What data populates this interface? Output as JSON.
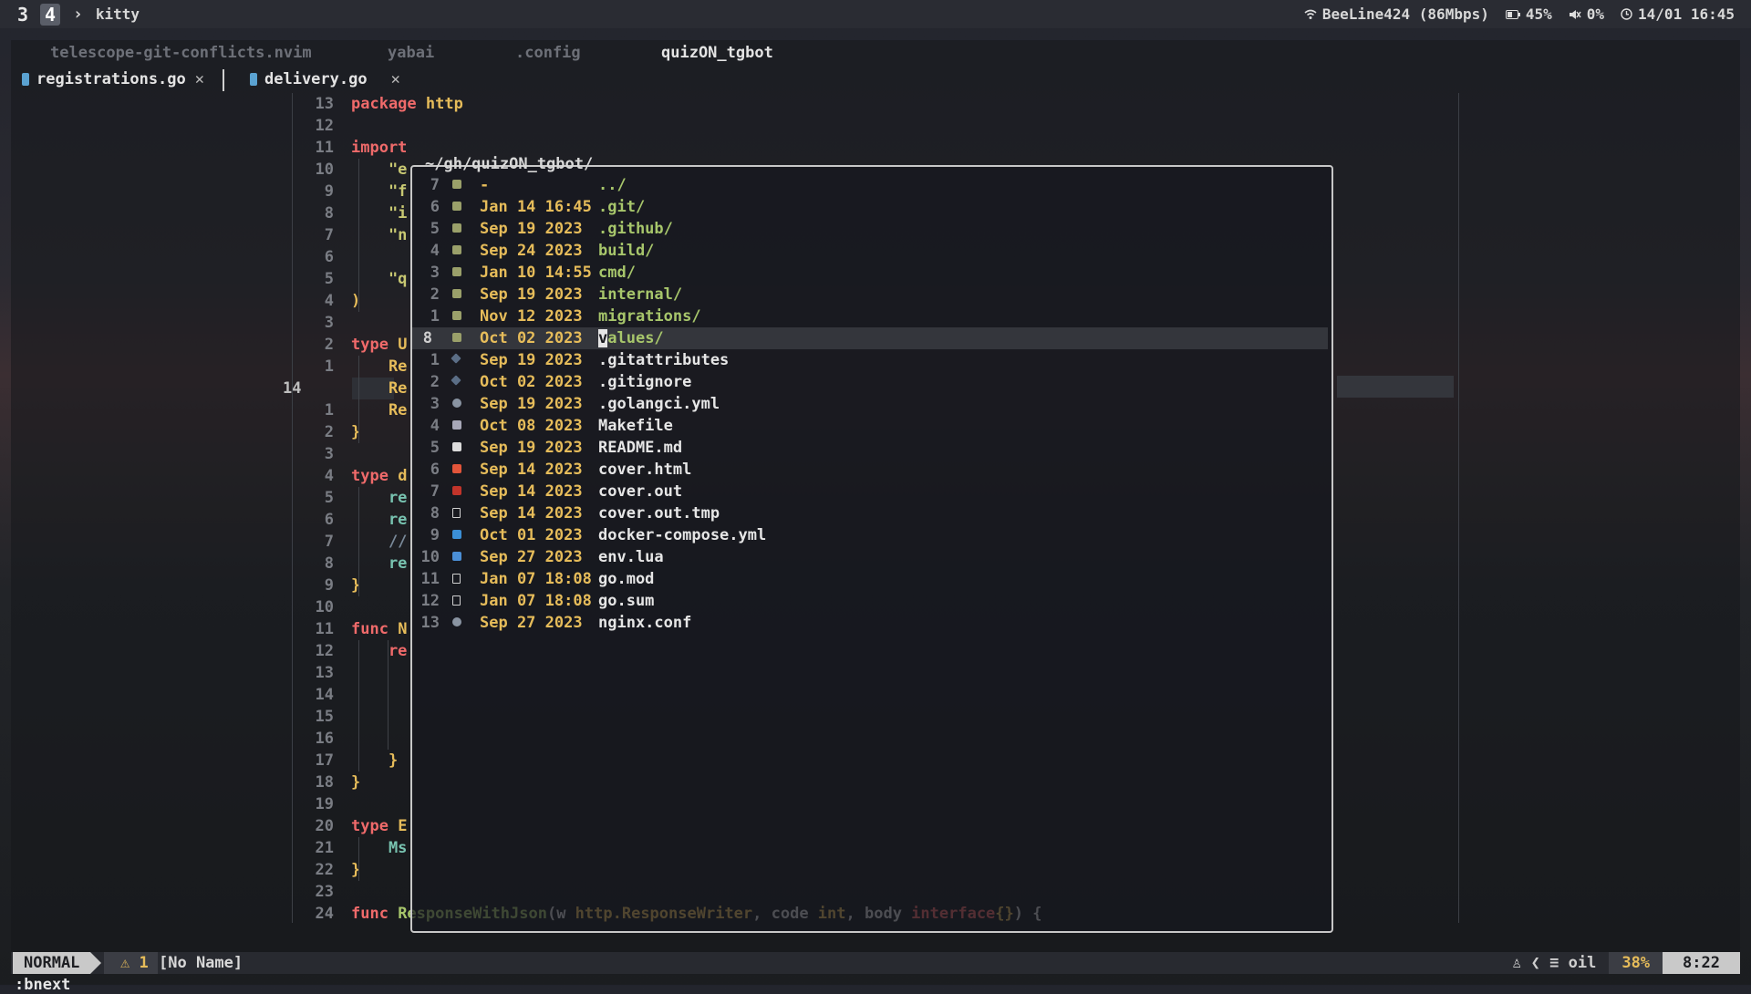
{
  "topbar": {
    "workspaces": [
      "3",
      "4"
    ],
    "active_workspace": "4",
    "chevron": "›",
    "app": "kitty",
    "wifi": "BeeLine424 (86Mbps)",
    "battery": "45%",
    "volume": "0%",
    "clock": "14/01 16:45"
  },
  "tabline": {
    "tabs": [
      "telescope-git-conflicts.nvim",
      "yabai",
      ".config",
      "quizON_tgbot"
    ],
    "current": "quizON_tgbot"
  },
  "buffers": [
    {
      "name": "registrations.go",
      "close": "✕"
    },
    {
      "name": "delivery.go",
      "close": "✕"
    }
  ],
  "editor": {
    "lines": [
      {
        "n": "13",
        "code": [
          [
            "kw",
            "package "
          ],
          [
            "ty",
            "http"
          ]
        ]
      },
      {
        "n": "12",
        "code": []
      },
      {
        "n": "11",
        "code": [
          [
            "kw",
            "import"
          ]
        ]
      },
      {
        "n": "10",
        "code": [
          [
            "str",
            "    \"e"
          ]
        ]
      },
      {
        "n": "9",
        "code": [
          [
            "str",
            "    \"f"
          ]
        ]
      },
      {
        "n": "8",
        "code": [
          [
            "str",
            "    \"i"
          ]
        ]
      },
      {
        "n": "7",
        "code": [
          [
            "str",
            "    \"n"
          ]
        ]
      },
      {
        "n": "6",
        "code": []
      },
      {
        "n": "5",
        "code": [
          [
            "str",
            "    \"q"
          ]
        ]
      },
      {
        "n": "4",
        "code": [
          [
            "ty",
            ")"
          ]
        ]
      },
      {
        "n": "3",
        "code": []
      },
      {
        "n": "2",
        "code": [
          [
            "kw",
            "type "
          ],
          [
            "ty",
            "U"
          ]
        ]
      },
      {
        "n": "1",
        "code": [
          [
            "ty",
            "    Re"
          ]
        ]
      },
      {
        "n": "14",
        "code": [
          [
            "ty",
            "    Re"
          ]
        ],
        "current": true
      },
      {
        "n": "1",
        "code": [
          [
            "ty",
            "    Re"
          ]
        ]
      },
      {
        "n": "2",
        "code": [
          [
            "ty",
            "}"
          ]
        ]
      },
      {
        "n": "3",
        "code": []
      },
      {
        "n": "4",
        "code": [
          [
            "kw",
            "type "
          ],
          [
            "ty",
            "d"
          ]
        ]
      },
      {
        "n": "5",
        "code": [
          [
            "teal",
            "    re"
          ]
        ]
      },
      {
        "n": "6",
        "code": [
          [
            "teal",
            "    re"
          ]
        ]
      },
      {
        "n": "7",
        "code": [
          [
            "cm",
            "    //"
          ]
        ]
      },
      {
        "n": "8",
        "code": [
          [
            "teal",
            "    re"
          ]
        ]
      },
      {
        "n": "9",
        "code": [
          [
            "ty",
            "}"
          ]
        ]
      },
      {
        "n": "10",
        "code": []
      },
      {
        "n": "11",
        "code": [
          [
            "kw",
            "func "
          ],
          [
            "ty",
            "N"
          ]
        ]
      },
      {
        "n": "12",
        "code": [
          [
            "kw",
            "    re"
          ]
        ]
      },
      {
        "n": "13",
        "code": []
      },
      {
        "n": "14",
        "code": []
      },
      {
        "n": "15",
        "code": []
      },
      {
        "n": "16",
        "code": []
      },
      {
        "n": "17",
        "code": [
          [
            "ty",
            "    }"
          ]
        ]
      },
      {
        "n": "18",
        "code": [
          [
            "ty",
            "}"
          ]
        ]
      },
      {
        "n": "19",
        "code": []
      },
      {
        "n": "20",
        "code": [
          [
            "kw",
            "type "
          ],
          [
            "ty",
            "E"
          ]
        ]
      },
      {
        "n": "21",
        "code": [
          [
            "teal",
            "    Ms"
          ]
        ]
      },
      {
        "n": "22",
        "code": [
          [
            "ty",
            "}"
          ]
        ]
      },
      {
        "n": "23",
        "code": []
      },
      {
        "n": "24",
        "code": [
          [
            "kw",
            "func "
          ],
          [
            "fn",
            "ResponseWithJson"
          ],
          [
            "plain",
            "(w "
          ],
          [
            "ty",
            "http.ResponseWriter"
          ],
          [
            "plain",
            ", code "
          ],
          [
            "ty",
            "int"
          ],
          [
            "plain",
            ", body "
          ],
          [
            "kw",
            "interface"
          ],
          [
            "ty",
            "{}"
          ],
          [
            "plain",
            ") {"
          ]
        ]
      }
    ]
  },
  "oil": {
    "title": "~/gh/quizON_tgbot/",
    "entries": [
      {
        "idx": "7",
        "icon": "folder-icon",
        "date": "-",
        "name": "../",
        "dir": true
      },
      {
        "idx": "6",
        "icon": "folder-icon",
        "date": "Jan 14 16:45",
        "name": ".git/",
        "dir": true
      },
      {
        "idx": "5",
        "icon": "folder-icon",
        "date": "Sep 19 2023",
        "name": ".github/",
        "dir": true
      },
      {
        "idx": "4",
        "icon": "folder-icon",
        "date": "Sep 24 2023",
        "name": "build/",
        "dir": true
      },
      {
        "idx": "3",
        "icon": "folder-icon",
        "date": "Jan 10 14:55",
        "name": "cmd/",
        "dir": true
      },
      {
        "idx": "2",
        "icon": "folder-icon",
        "date": "Sep 19 2023",
        "name": "internal/",
        "dir": true
      },
      {
        "idx": "1",
        "icon": "folder-icon",
        "date": "Nov 12 2023",
        "name": "migrations/",
        "dir": true
      },
      {
        "idx": "8",
        "icon": "folder-icon",
        "date": "Oct 02 2023",
        "name": "values/",
        "dir": true,
        "selected": true
      },
      {
        "idx": "1",
        "icon": "git-icon",
        "date": "Sep 19 2023",
        "name": ".gitattributes",
        "dir": false
      },
      {
        "idx": "2",
        "icon": "git-icon",
        "date": "Oct 02 2023",
        "name": ".gitignore",
        "dir": false
      },
      {
        "idx": "3",
        "icon": "gear-icon",
        "date": "Sep 19 2023",
        "name": ".golangci.yml",
        "dir": false
      },
      {
        "idx": "4",
        "icon": "makefile-icon",
        "date": "Oct 08 2023",
        "name": "Makefile",
        "dir": false
      },
      {
        "idx": "5",
        "icon": "markdown-icon",
        "date": "Sep 19 2023",
        "name": "README.md",
        "dir": false
      },
      {
        "idx": "6",
        "icon": "html-icon",
        "date": "Sep 14 2023",
        "name": "cover.html",
        "dir": false
      },
      {
        "idx": "7",
        "icon": "out-icon",
        "date": "Sep 14 2023",
        "name": "cover.out",
        "dir": false
      },
      {
        "idx": "8",
        "icon": "file-icon",
        "date": "Sep 14 2023",
        "name": "cover.out.tmp",
        "dir": false
      },
      {
        "idx": "9",
        "icon": "docker-icon",
        "date": "Oct 01 2023",
        "name": "docker-compose.yml",
        "dir": false
      },
      {
        "idx": "10",
        "icon": "lua-icon",
        "date": "Sep 27 2023",
        "name": "env.lua",
        "dir": false
      },
      {
        "idx": "11",
        "icon": "file-icon",
        "date": "Jan 07 18:08",
        "name": "go.mod",
        "dir": false
      },
      {
        "idx": "12",
        "icon": "file-icon",
        "date": "Jan 07 18:08",
        "name": "go.sum",
        "dir": false
      },
      {
        "idx": "13",
        "icon": "gear-icon",
        "date": "Sep 27 2023",
        "name": "nginx.conf",
        "dir": false
      }
    ]
  },
  "statusline": {
    "mode": "NORMAL",
    "warnings": "⚠ 1",
    "buffer": "[No Name]",
    "filetype": "oil",
    "percent": "38%",
    "position": "8:22"
  },
  "cmdline": ":bnext",
  "colors": {
    "keyword": "#ef6a6a",
    "type": "#e6bc5a",
    "function": "#a7c66b",
    "directory": "#a7c66b"
  }
}
